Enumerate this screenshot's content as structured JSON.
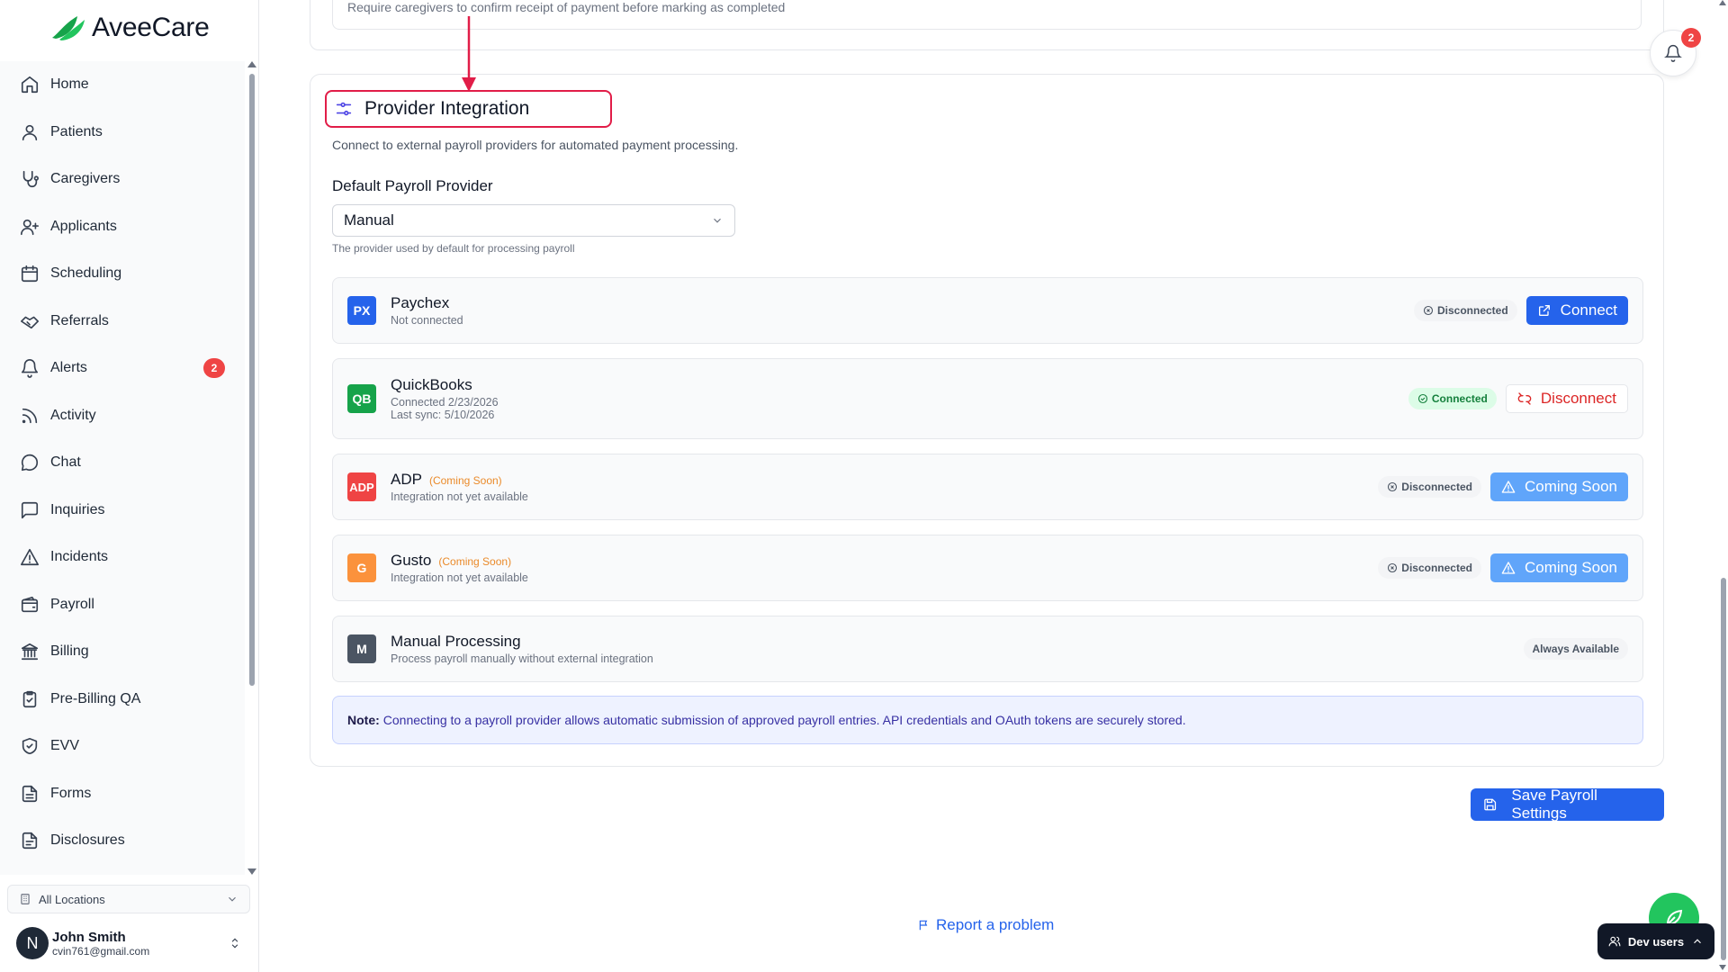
{
  "app": {
    "brand": "AveeCare"
  },
  "sidebar": {
    "items": [
      {
        "label": "Home",
        "icon": "home-icon"
      },
      {
        "label": "Patients",
        "icon": "user-icon"
      },
      {
        "label": "Caregivers",
        "icon": "stethoscope-icon"
      },
      {
        "label": "Applicants",
        "icon": "user-plus-icon"
      },
      {
        "label": "Scheduling",
        "icon": "calendar-icon"
      },
      {
        "label": "Referrals",
        "icon": "handshake-icon"
      },
      {
        "label": "Alerts",
        "icon": "bell-icon",
        "badge": "2"
      },
      {
        "label": "Activity",
        "icon": "rss-icon"
      },
      {
        "label": "Chat",
        "icon": "message-circle-icon"
      },
      {
        "label": "Inquiries",
        "icon": "message-square-icon"
      },
      {
        "label": "Incidents",
        "icon": "alert-triangle-icon"
      },
      {
        "label": "Payroll",
        "icon": "wallet-icon"
      },
      {
        "label": "Billing",
        "icon": "landmark-icon"
      },
      {
        "label": "Pre-Billing QA",
        "icon": "clipboard-check-icon"
      },
      {
        "label": "EVV",
        "icon": "shield-check-icon"
      },
      {
        "label": "Forms",
        "icon": "file-text-icon"
      },
      {
        "label": "Disclosures",
        "icon": "file-icon"
      }
    ],
    "location": "All Locations",
    "user": {
      "initial": "N",
      "name": "John Smith",
      "email": "cvin761@gmail.com"
    }
  },
  "top_card": {
    "text": "Require caregivers to confirm receipt of payment before marking as completed"
  },
  "provider_integration": {
    "title": "Provider Integration",
    "description": "Connect to external payroll providers for automated payment processing.",
    "default_label": "Default Payroll Provider",
    "default_value": "Manual",
    "default_help": "The provider used by default for processing payroll",
    "providers": [
      {
        "abbr": "PX",
        "color": "#2563eb",
        "name": "Paychex",
        "soon": "",
        "sub1": "Not connected",
        "sub2": "",
        "status": "Disconnected",
        "action": "Connect"
      },
      {
        "abbr": "QB",
        "color": "#16a34a",
        "name": "QuickBooks",
        "soon": "",
        "sub1": "Connected 2/23/2026",
        "sub2": "Last sync: 5/10/2026",
        "status": "Connected",
        "action": "Disconnect"
      },
      {
        "abbr": "ADP",
        "color": "#ef4444",
        "name": "ADP",
        "soon": "(Coming Soon)",
        "sub1": "Integration not yet available",
        "sub2": "",
        "status": "Disconnected",
        "action": "Coming Soon"
      },
      {
        "abbr": "G",
        "color": "#f97316",
        "name": "Gusto",
        "soon": "(Coming Soon)",
        "sub1": "Integration not yet available",
        "sub2": "",
        "status": "Disconnected",
        "action": "Coming Soon"
      },
      {
        "abbr": "M",
        "color": "#4b5563",
        "name": "Manual Processing",
        "soon": "",
        "sub1": "Process payroll manually without external integration",
        "sub2": "",
        "status": "Always Available",
        "action": ""
      }
    ],
    "note_label": "Note:",
    "note_text": "Connecting to a payroll provider allows automatic submission of approved payroll entries. API credentials and OAuth tokens are securely stored."
  },
  "save_button": "Save Payroll Settings",
  "report_link": "Report a problem",
  "notifications": {
    "badge": "2"
  },
  "dev_users": "Dev users",
  "colors": {
    "primary": "#2563eb",
    "highlight": "#e11d48",
    "success": "#16a34a",
    "danger": "#dc2626"
  }
}
